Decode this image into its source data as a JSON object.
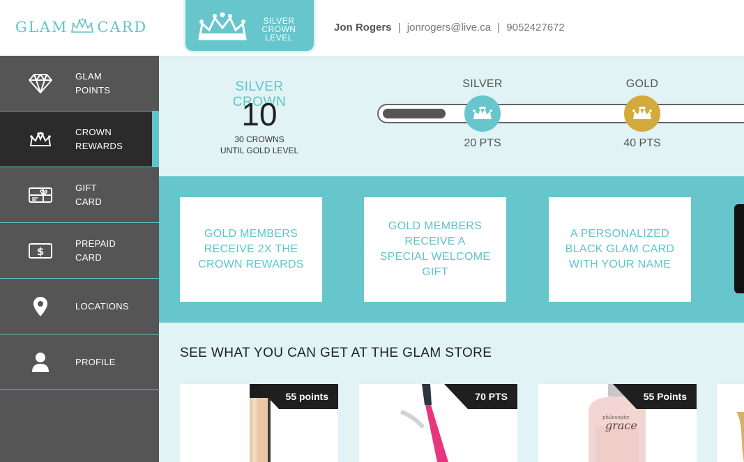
{
  "header": {
    "logo_left": "GLAM",
    "logo_right": "CARD",
    "level_tab": {
      "line1": "SILVER",
      "line2": "CROWN",
      "line3": "LEVEL"
    },
    "user": {
      "name": "Jon Rogers",
      "email": "jonrogers@live.ca",
      "phone": "9052427672",
      "separator": "|"
    }
  },
  "sidebar": {
    "items": [
      {
        "line1": "GLAM",
        "line2": "POINTS",
        "icon": "diamond-icon",
        "active": false
      },
      {
        "line1": "CROWN",
        "line2": "REWARDS",
        "icon": "crown-icon",
        "active": true
      },
      {
        "line1": "GIFT",
        "line2": "CARD",
        "icon": "gift-card-icon",
        "active": false
      },
      {
        "line1": "PREPAID",
        "line2": "CARD",
        "icon": "dollar-card-icon",
        "active": false
      },
      {
        "line1": "LOCATIONS",
        "line2": "",
        "icon": "map-pin-icon",
        "active": false
      },
      {
        "line1": "PROFILE",
        "line2": "",
        "icon": "user-icon",
        "active": false
      }
    ]
  },
  "progress": {
    "title": "SILVER CROWN",
    "crowns": "10",
    "sub_line1": "30 CROWNS",
    "sub_line2": "UNTIL GOLD LEVEL",
    "fill_fraction": 0.25,
    "tiers": [
      {
        "name": "SILVER",
        "points": "20 PTS",
        "color": "#66c6cb"
      },
      {
        "name": "GOLD",
        "points": "40 PTS",
        "color": "#d3aa3c"
      }
    ]
  },
  "benefits": [
    "GOLD MEMBERS RECEIVE 2X THE CROWN REWARDS",
    "GOLD MEMBERS RECEIVE A SPECIAL WELCOME GIFT",
    "A PERSONALIZED BLACK GLAM CARD WITH YOUR NAME"
  ],
  "store": {
    "heading": "SEE WHAT YOU CAN GET AT THE GLAM STORE",
    "products": [
      {
        "points": "55 points"
      },
      {
        "points": "70 PTS"
      },
      {
        "points": "55 Points",
        "brand_text": "grace",
        "brand_small": "philosophy"
      }
    ]
  },
  "colors": {
    "accent": "#5fc4c9",
    "accent_dark": "#66c6cb",
    "light_bg": "#e1f3f4",
    "sidebar": "#555555",
    "sidebar_active": "#2b2b2b",
    "gold": "#d3aa3c"
  }
}
